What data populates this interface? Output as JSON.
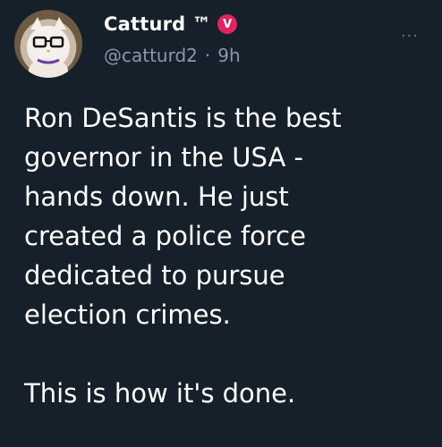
{
  "tweet": {
    "display_name": "Catturd ™",
    "badge": "V",
    "handle": "@catturd2",
    "separator": "·",
    "time": "9h",
    "more": "···",
    "text": "Ron DeSantis is the best\ngovernor in the USA -\nhands down. He just\ncreated a police force\ndedicated to pursue\nelection crimes.\n\nThis is how it's done."
  },
  "colors": {
    "background": "#15202b",
    "text": "#ffffff",
    "secondary": "#8b98a5",
    "badge": "#e0245e"
  }
}
